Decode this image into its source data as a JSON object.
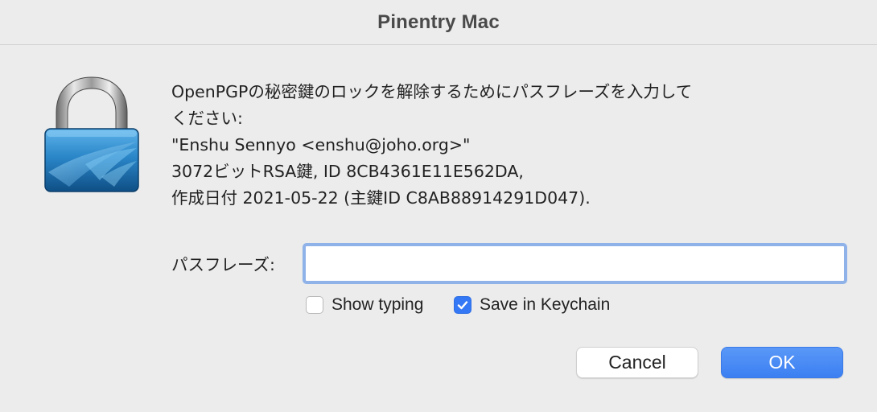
{
  "window": {
    "title": "Pinentry Mac"
  },
  "message": {
    "lines": [
      "OpenPGPの秘密鍵のロックを解除するためにパスフレーズを入力して",
      "ください:",
      "\"Enshu Sennyo <enshu@joho.org>\"",
      "3072ビットRSA鍵, ID 8CB4361E11E562DA,",
      "作成日付 2021-05-22 (主鍵ID C8AB88914291D047)."
    ]
  },
  "passphrase": {
    "label": "パスフレーズ:",
    "value": ""
  },
  "options": {
    "show_typing": {
      "label": "Show typing",
      "checked": false
    },
    "save_in_keychain": {
      "label": "Save in Keychain",
      "checked": true
    }
  },
  "buttons": {
    "cancel_label": "Cancel",
    "ok_label": "OK"
  },
  "icons": {
    "app_icon": "padlock-icon",
    "checkmark": "checkmark-icon"
  },
  "colors": {
    "accent": "#3478f6",
    "focus_ring": "#8fb2e8",
    "background": "#ececec"
  }
}
